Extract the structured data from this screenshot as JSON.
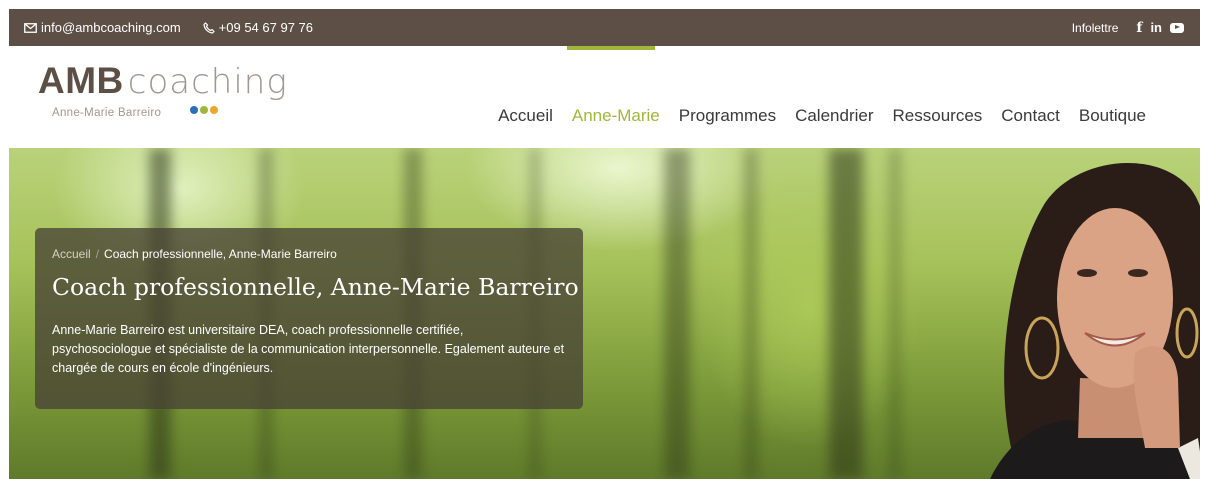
{
  "topbar": {
    "email": "info@ambcoaching.com",
    "phone": "+09 54 67 97 76",
    "newsletter": "Infolettre",
    "social": {
      "facebook": "f",
      "linkedin": "in"
    }
  },
  "logo": {
    "amb": "AMB",
    "coaching": "coaching",
    "subtitle": "Anne-Marie Barreiro",
    "dot_colors": [
      "#2c6fb4",
      "#a0b73b",
      "#e8a92a"
    ]
  },
  "nav": {
    "items": [
      {
        "label": "Accueil"
      },
      {
        "label": "Anne-Marie"
      },
      {
        "label": "Programmes"
      },
      {
        "label": "Calendrier"
      },
      {
        "label": "Ressources"
      },
      {
        "label": "Contact"
      },
      {
        "label": "Boutique"
      }
    ],
    "active_index": 1,
    "accent_color": "#a0b73b"
  },
  "hero": {
    "breadcrumb": {
      "home": "Accueil",
      "separator": "/",
      "current": "Coach professionnelle, Anne-Marie Barreiro"
    },
    "title": "Coach professionnelle, Anne-Marie Barreiro",
    "description": "Anne-Marie Barreiro est universitaire DEA, coach professionnelle certifiée, psychosociologue et spécialiste de la communication interpersonnelle. Egalement auteure et chargée de cours en école d'ingénieurs."
  }
}
